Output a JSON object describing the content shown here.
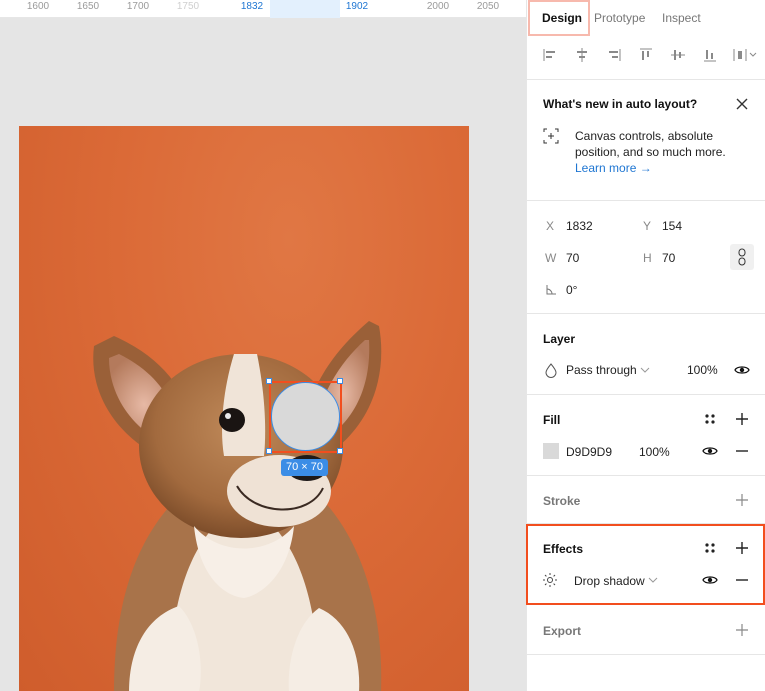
{
  "ruler": {
    "ticks": [
      {
        "label": "1600",
        "style": "normal"
      },
      {
        "label": "1650",
        "style": "normal"
      },
      {
        "label": "1700",
        "style": "normal"
      },
      {
        "label": "1750",
        "style": "faint"
      },
      {
        "label": "1832",
        "style": "sel"
      },
      {
        "label": "1902",
        "style": "sel"
      },
      {
        "label": "2000",
        "style": "normal"
      },
      {
        "label": "2050",
        "style": "normal"
      }
    ]
  },
  "canvas": {
    "size_tag": "70 × 70",
    "fill_color": "#d9d9d9",
    "selection_color": "#3b8de6",
    "highlight_color": "#f24e1e"
  },
  "panel": {
    "tabs": {
      "design": "Design",
      "prototype": "Prototype",
      "inspect": "Inspect"
    },
    "whats_new": {
      "title": "What's new in auto layout?",
      "body_line1": "Canvas controls, absolute",
      "body_line2": "position, and so much more.",
      "link": "Learn more →"
    },
    "position": {
      "x_label": "X",
      "x_value": "1832",
      "y_label": "Y",
      "y_value": "154",
      "w_label": "W",
      "w_value": "70",
      "h_label": "H",
      "h_value": "70",
      "rotation": "0°"
    },
    "layer": {
      "title": "Layer",
      "blend": "Pass through",
      "opacity": "100%"
    },
    "fill": {
      "title": "Fill",
      "hex": "D9D9D9",
      "opacity": "100%",
      "swatch": "#d9d9d9"
    },
    "stroke": {
      "title": "Stroke"
    },
    "effects": {
      "title": "Effects",
      "effect": "Drop shadow"
    },
    "export": {
      "title": "Export"
    }
  }
}
